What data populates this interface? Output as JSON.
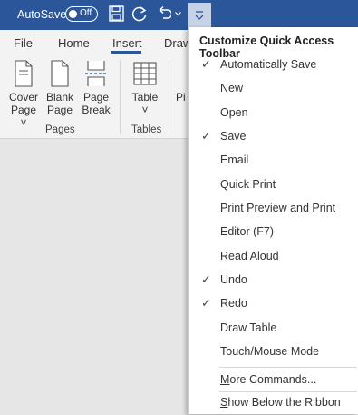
{
  "titlebar": {
    "autosave_label": "AutoSave",
    "autosave_state": "Off",
    "accent_color": "#2b579a"
  },
  "ribbon": {
    "tabs": [
      {
        "label": "File"
      },
      {
        "label": "Home"
      },
      {
        "label": "Insert",
        "active": true
      },
      {
        "label": "Draw"
      }
    ],
    "buttons": {
      "cover_page": {
        "line1": "Cover",
        "line2": "Page ˅",
        "icon": "cover-page-icon"
      },
      "blank_page": {
        "line1": "Blank",
        "line2": "Page",
        "icon": "blank-page-icon"
      },
      "page_break": {
        "line1": "Page",
        "line2": "Break",
        "icon": "page-break-icon"
      },
      "table": {
        "line1": "Table",
        "line2": "˅",
        "icon": "table-icon"
      },
      "pictures_partial": "Pi"
    },
    "groups": {
      "pages": "Pages",
      "tables": "Tables"
    }
  },
  "menu": {
    "title": "Customize Quick Access Toolbar",
    "items": [
      {
        "label": "Automatically Save",
        "checked": true
      },
      {
        "label": "New",
        "checked": false
      },
      {
        "label": "Open",
        "checked": false
      },
      {
        "label": "Save",
        "checked": true
      },
      {
        "label": "Email",
        "checked": false
      },
      {
        "label": "Quick Print",
        "checked": false
      },
      {
        "label": "Print Preview and Print",
        "checked": false
      },
      {
        "label": "Editor (F7)",
        "checked": false
      },
      {
        "label": "Read Aloud",
        "checked": false
      },
      {
        "label": "Undo",
        "checked": true
      },
      {
        "label": "Redo",
        "checked": true
      },
      {
        "label": "Draw Table",
        "checked": false
      },
      {
        "label": "Touch/Mouse Mode",
        "checked": false
      }
    ],
    "more_commands": {
      "u": "M",
      "rest": "ore Commands..."
    },
    "show_below": {
      "u": "S",
      "rest": "how Below the Ribbon"
    },
    "check_glyph": "✓"
  }
}
